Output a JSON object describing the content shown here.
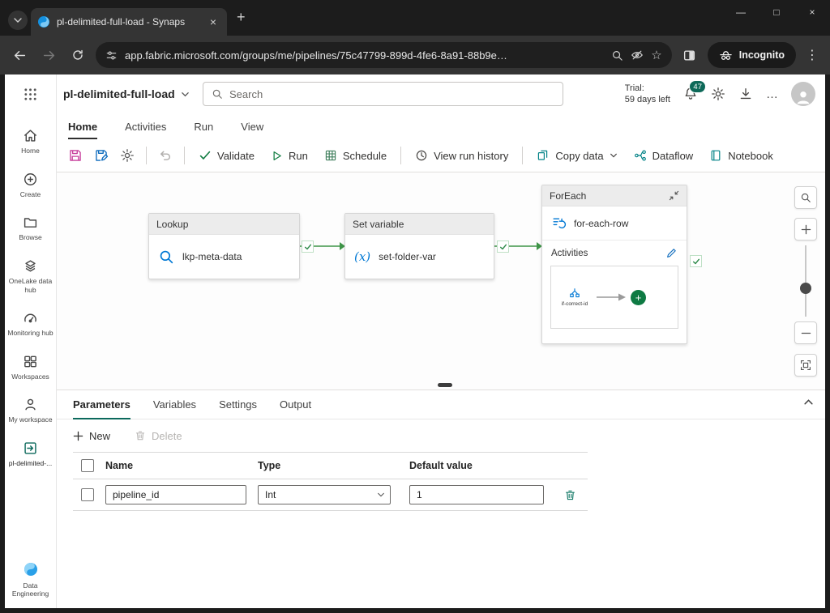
{
  "browser": {
    "tab": {
      "title": "pl-delimited-full-load - Synaps"
    },
    "url": "app.fabric.microsoft.com/groups/me/pipelines/75c47799-899d-4fe6-8a91-88b9e…",
    "incognito": "Incognito"
  },
  "glyphs": {
    "close": "×",
    "minimize": "—",
    "maximize": "□",
    "new_tab": "+",
    "menu_vertical": "⋮",
    "menu_horizontal": "…",
    "star": "☆",
    "plus": "+"
  },
  "app_header": {
    "title": "pl-delimited-full-load",
    "search_placeholder": "Search",
    "trial_label": "Trial:",
    "trial_value": "59 days left",
    "notification_count": "47"
  },
  "ribbon": {
    "tabs": [
      {
        "label": "Home"
      },
      {
        "label": "Activities"
      },
      {
        "label": "Run"
      },
      {
        "label": "View"
      }
    ],
    "actions": {
      "validate": "Validate",
      "run": "Run",
      "schedule": "Schedule",
      "view_run_history": "View run history",
      "copy_data": "Copy data",
      "dataflow": "Dataflow",
      "notebook": "Notebook"
    }
  },
  "sidebar": {
    "items": [
      {
        "label": "Home"
      },
      {
        "label": "Create"
      },
      {
        "label": "Browse"
      },
      {
        "label": "OneLake data hub"
      },
      {
        "label": "Monitoring hub"
      },
      {
        "label": "Workspaces"
      },
      {
        "label": "My workspace"
      },
      {
        "label": "pl-delimited-..."
      },
      {
        "label": "Data Engineering"
      }
    ]
  },
  "canvas": {
    "lookup": {
      "type": "Lookup",
      "name": "lkp-meta-data"
    },
    "set_variable": {
      "type": "Set variable",
      "name": "set-folder-var",
      "icon_glyph": "(x)"
    },
    "foreach": {
      "title": "ForEach",
      "name": "for-each-row",
      "activities_label": "Activities",
      "activity_name": "if-correct-id"
    }
  },
  "panel": {
    "tabs": [
      {
        "label": "Parameters"
      },
      {
        "label": "Variables"
      },
      {
        "label": "Settings"
      },
      {
        "label": "Output"
      }
    ],
    "new_label": "New",
    "delete_label": "Delete",
    "columns": [
      "Name",
      "Type",
      "Default value"
    ],
    "rows": [
      {
        "name": "pipeline_id",
        "type": "Int",
        "default_value": "1"
      }
    ]
  },
  "colors": {
    "accent_teal": "#0c695c",
    "office_teal": "#038387",
    "green": "#107c41",
    "node_blue": "#0078d4",
    "save_pink": "#c73e9b"
  }
}
